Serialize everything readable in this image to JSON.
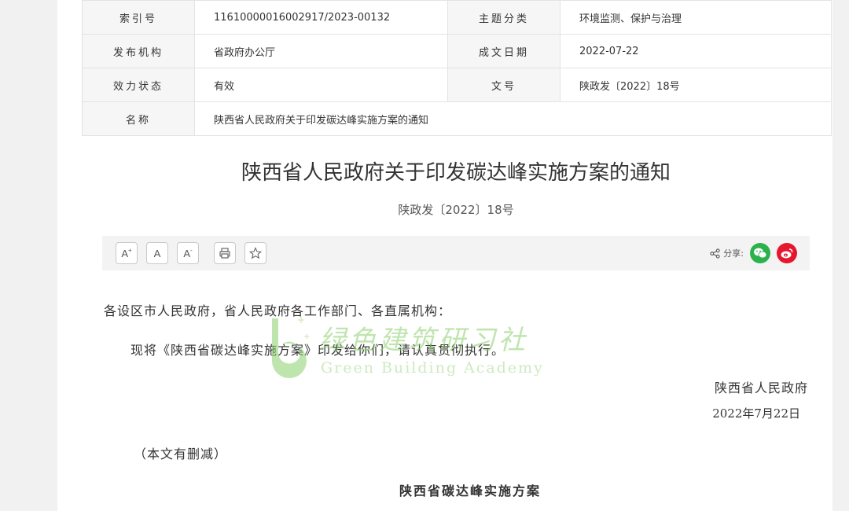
{
  "meta": {
    "r1": {
      "k1": "索引号",
      "v1": "11610000016002917/2023-00132",
      "k2": "主题分类",
      "v2": "环境监测、保护与治理"
    },
    "r2": {
      "k1": "发布机构",
      "v1": "省政府办公厅",
      "k2": "成文日期",
      "v2": "2022-07-22"
    },
    "r3": {
      "k1": "效力状态",
      "v1": "有效",
      "k2": "文号",
      "v2": "陕政发〔2022〕18号"
    },
    "r4": {
      "k1": "名称",
      "v1": "陕西省人民政府关于印发碳达峰实施方案的通知"
    }
  },
  "title": "陕西省人民政府关于印发碳达峰实施方案的通知",
  "doc_number": "陕政发〔2022〕18号",
  "toolbar": {
    "font_larger": "A",
    "font_larger_sup": "+",
    "font_normal": "A",
    "font_smaller": "A",
    "font_smaller_sup": "-",
    "share_label": "分享:"
  },
  "body": {
    "salutation": "各设区市人民政府，省人民政府各工作部门、各直属机构：",
    "paragraph": "现将《陕西省碳达峰实施方案》印发给你们，请认真贯彻执行。",
    "signature": "陕西省人民政府",
    "date": "2022年7月22日",
    "note": "（本文有删减）",
    "subtitle": "陕西省碳达峰实施方案"
  },
  "watermark": {
    "cn": "绿色建筑研习社",
    "en": "Green Building Academy"
  },
  "colors": {
    "wechat": "#2bb24c",
    "weibo": "#e6162d",
    "watermark": "#8bd06d"
  }
}
